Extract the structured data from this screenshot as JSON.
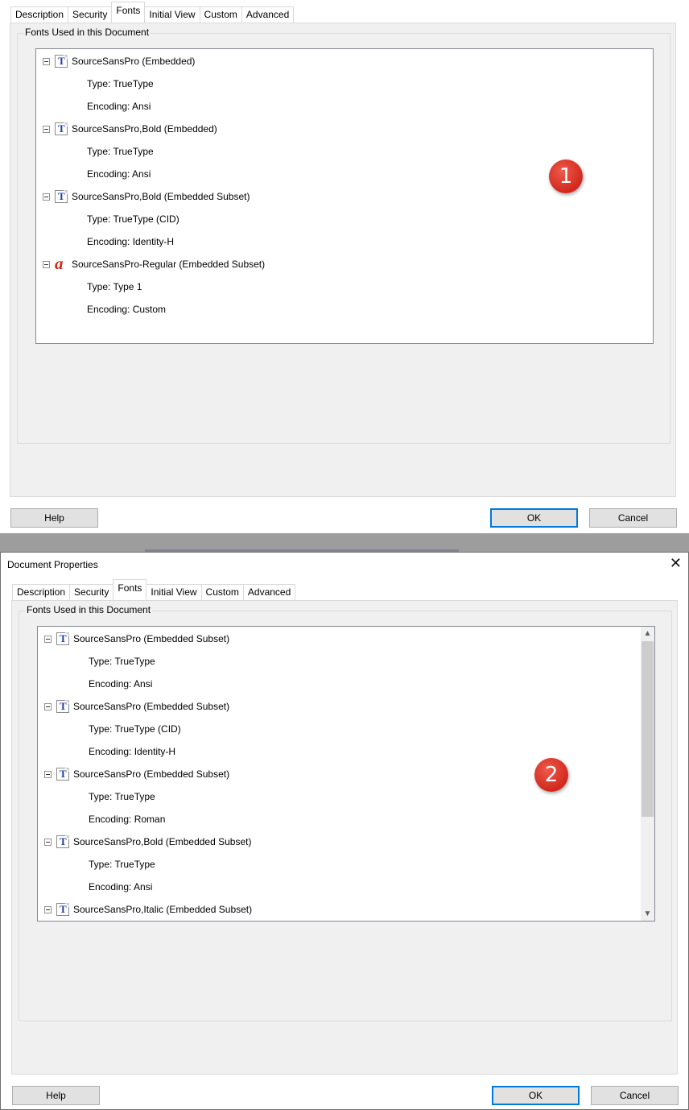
{
  "dialog1": {
    "tabs": [
      "Description",
      "Security",
      "Fonts",
      "Initial View",
      "Custom",
      "Advanced"
    ],
    "active_tab": "Fonts",
    "group_label": "Fonts Used in this Document",
    "fonts": [
      {
        "name": "SourceSansPro (Embedded)",
        "icon": "truetype-font-icon",
        "type": "Type: TrueType",
        "encoding": "Encoding: Ansi"
      },
      {
        "name": "SourceSansPro,Bold (Embedded)",
        "icon": "truetype-font-icon",
        "type": "Type: TrueType",
        "encoding": "Encoding: Ansi"
      },
      {
        "name": "SourceSansPro,Bold (Embedded Subset)",
        "icon": "truetype-font-icon",
        "type": "Type: TrueType (CID)",
        "encoding": "Encoding: Identity-H"
      },
      {
        "name": "SourceSansPro-Regular (Embedded Subset)",
        "icon": "type1-font-icon",
        "type": "Type: Type 1",
        "encoding": "Encoding: Custom"
      }
    ],
    "badge": "1",
    "buttons": {
      "help": "Help",
      "ok": "OK",
      "cancel": "Cancel"
    }
  },
  "dialog2": {
    "title": "Document Properties",
    "close_glyph": "✕",
    "tabs": [
      "Description",
      "Security",
      "Fonts",
      "Initial View",
      "Custom",
      "Advanced"
    ],
    "active_tab": "Fonts",
    "group_label": "Fonts Used in this Document",
    "fonts": [
      {
        "name": "SourceSansPro (Embedded Subset)",
        "icon": "truetype-font-icon",
        "type": "Type: TrueType",
        "encoding": "Encoding: Ansi"
      },
      {
        "name": "SourceSansPro (Embedded Subset)",
        "icon": "truetype-font-icon",
        "type": "Type: TrueType (CID)",
        "encoding": "Encoding: Identity-H"
      },
      {
        "name": "SourceSansPro (Embedded Subset)",
        "icon": "truetype-font-icon",
        "type": "Type: TrueType",
        "encoding": "Encoding: Roman"
      },
      {
        "name": "SourceSansPro,Bold (Embedded Subset)",
        "icon": "truetype-font-icon",
        "type": "Type: TrueType",
        "encoding": "Encoding: Ansi"
      },
      {
        "name": "SourceSansPro,Italic (Embedded Subset)",
        "icon": "truetype-font-icon"
      }
    ],
    "badge": "2",
    "buttons": {
      "help": "Help",
      "ok": "OK",
      "cancel": "Cancel"
    }
  },
  "colors": {
    "badge": "#d2281d",
    "ok_border": "#0078d7",
    "truetype_glyph": "#1f3fa4",
    "type1_glyph": "#d1271e"
  }
}
